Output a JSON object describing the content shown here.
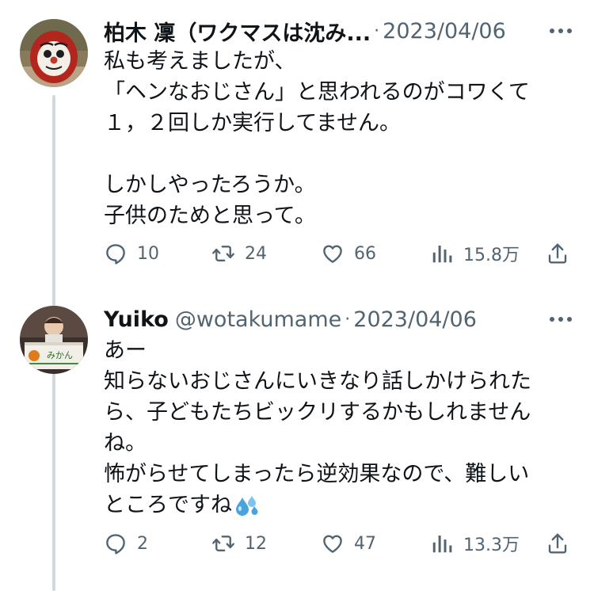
{
  "tweets": [
    {
      "display_name": "柏木 凜（ワクマスは沈み...",
      "handle": "",
      "separator": "·",
      "date": "2023/04/06",
      "lines": [
        "私も考えましたが、",
        "「ヘンなおじさん」と思われるのがコワくて",
        "１，２回しか実行してません。",
        "",
        "しかしやったろうか。",
        "子供のためと思って。"
      ],
      "reply_count": "10",
      "retweet_count": "24",
      "like_count": "66",
      "views_count": "15.8万",
      "avatar_icon": "daruma-avatar"
    },
    {
      "display_name": "Yuiko",
      "handle": "@wotakumame",
      "separator": "·",
      "date": "2023/04/06",
      "lines": [
        "あー",
        "知らないおじさんにいきなり話しかけられた",
        "ら、子どもたちビックリするかもしれません",
        "ね。",
        "怖がらせてしまったら逆効果なので、難しい",
        "ところですね"
      ],
      "trailing_emoji": "sweat-droplets-emoji",
      "reply_count": "2",
      "retweet_count": "12",
      "like_count": "47",
      "views_count": "13.3万",
      "avatar_icon": "baby-in-box-avatar",
      "avatar_box_text": "みかん"
    }
  ],
  "colors": {
    "text": "#0f1419",
    "secondary": "#536471",
    "thread_line": "#cfd9de",
    "background": "#ffffff"
  }
}
